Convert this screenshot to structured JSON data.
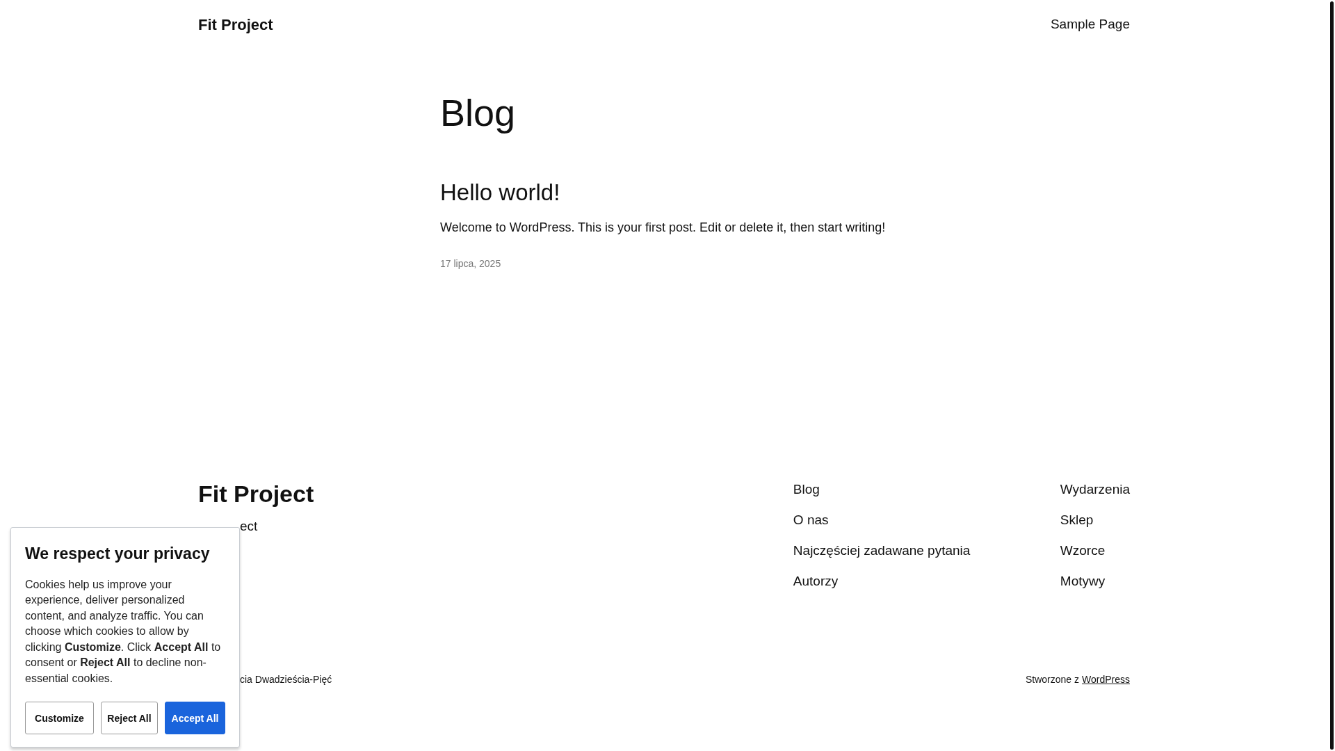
{
  "header": {
    "site_title": "Fit Project",
    "nav": [
      "Sample Page"
    ]
  },
  "page_title": "Blog",
  "posts": [
    {
      "title": "Hello world!",
      "excerpt": "Welcome to WordPress. This is your first post. Edit or delete it, then start writing!",
      "date": "17 lipca, 2025"
    }
  ],
  "footer": {
    "site_title": "Fit Project",
    "tagline": "ect",
    "nav_columns": [
      [
        "Blog",
        "O nas",
        "Najczęściej zadawane pytania",
        "Autorzy"
      ],
      [
        "Wydarzenia",
        "Sklep",
        "Wzorce",
        "Motywy"
      ]
    ],
    "credit_left": "cia Dwadzieścia-Pięć",
    "credit_right": "Stworzone z",
    "credit_link": "WordPress"
  },
  "cookie_banner": {
    "title": "We respect your privacy",
    "text": "Cookies help us improve your experience, deliver personalized content, and analyze traffic. You can choose which cookies to allow by clicking **Customize**. Click **Accept All** to consent or **Reject All** to decline non-essential cookies.",
    "buttons": [
      {
        "label": "Customize",
        "kind": "outline"
      },
      {
        "label": "Reject All",
        "kind": "outline"
      },
      {
        "label": "Accept All",
        "kind": "primary"
      }
    ]
  }
}
